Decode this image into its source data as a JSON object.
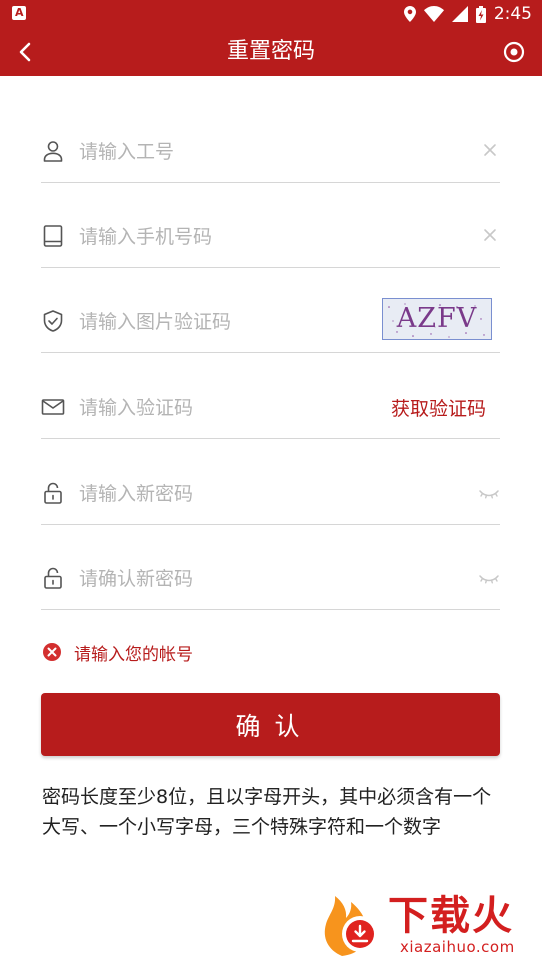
{
  "status_bar": {
    "time": "2:45",
    "app_badge": "A"
  },
  "header": {
    "title": "重置密码"
  },
  "form": {
    "employee_id": {
      "placeholder": "请输入工号",
      "value": ""
    },
    "phone": {
      "placeholder": "请输入手机号码",
      "value": ""
    },
    "captcha_input": {
      "placeholder": "请输入图片验证码",
      "value": ""
    },
    "captcha_image_text": "AZFV",
    "sms_code": {
      "placeholder": "请输入验证码",
      "value": ""
    },
    "get_code_label": "获取验证码",
    "new_password": {
      "placeholder": "请输入新密码",
      "value": ""
    },
    "confirm_password": {
      "placeholder": "请确认新密码",
      "value": ""
    }
  },
  "error": {
    "message": "请输入您的帐号"
  },
  "confirm_button": {
    "label": "确认"
  },
  "hint": {
    "text": "密码长度至少8位，且以字母开头，其中必须含有一个大写、一个小写字母，三个特殊字符和一个数字"
  },
  "watermark": {
    "title": "下载火",
    "subtitle": "xiazaihuo.com"
  },
  "colors": {
    "primary": "#b71c1c",
    "placeholder": "#b4b4b4",
    "divider": "#d6d6d6",
    "icon": "#555555"
  }
}
